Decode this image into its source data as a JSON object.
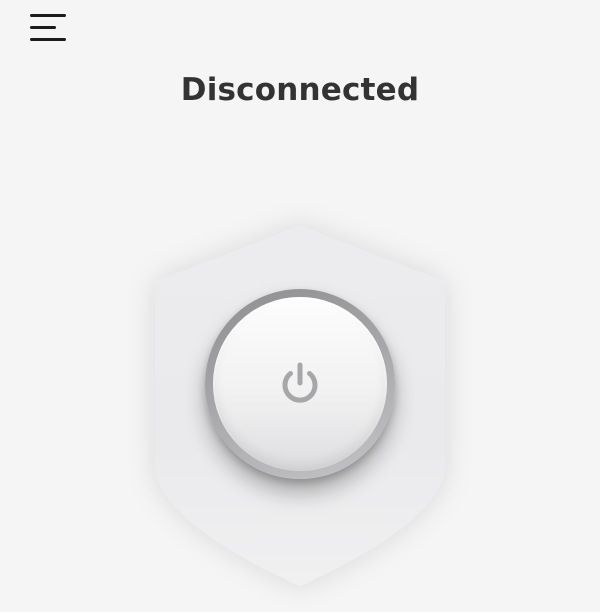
{
  "header": {
    "menu_icon": "hamburger-menu-icon"
  },
  "status": {
    "label": "Disconnected"
  },
  "connect_button": {
    "icon": "power-icon"
  },
  "colors": {
    "background": "#f5f5f6",
    "title_text": "#333333",
    "icon_stroke": "#a7a7a9",
    "ring": "#9a9a9c"
  }
}
